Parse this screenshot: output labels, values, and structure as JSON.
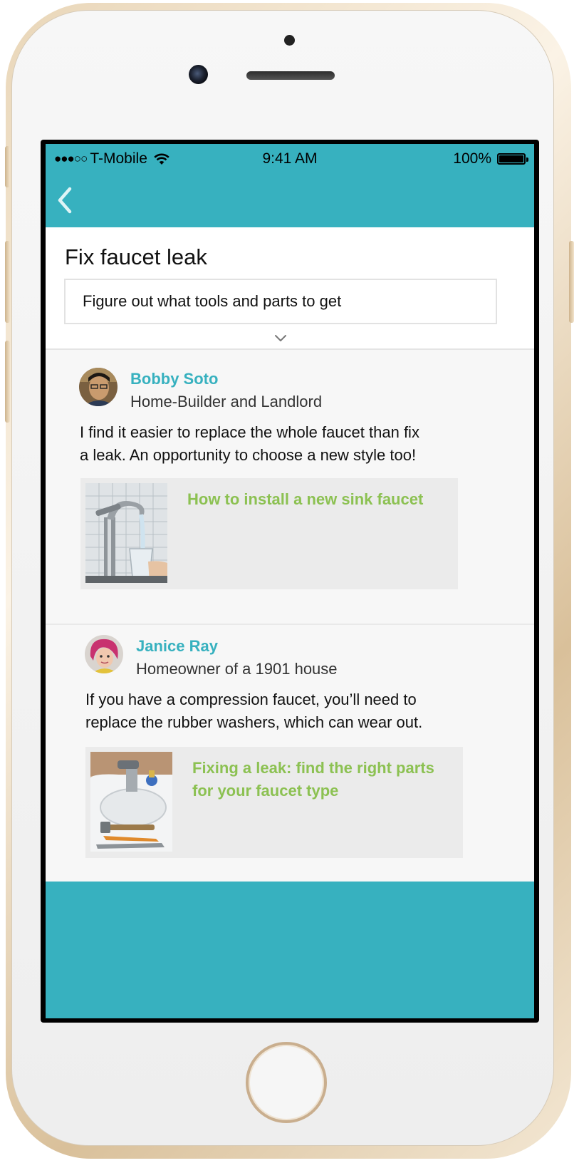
{
  "status_bar": {
    "signal": "●●●○○",
    "carrier": "T-Mobile",
    "time": "9:41 AM",
    "battery": "100%"
  },
  "nav": {
    "back_icon": "chevron-left-icon"
  },
  "task": {
    "title": "Fix faucet leak",
    "step": "Figure out what tools and parts to get",
    "expand_icon": "chevron-down-icon"
  },
  "answers": [
    {
      "author": "Bobby Soto",
      "role": "Home-Builder and Landlord",
      "text_line1": "I find it easier to replace the whole faucet than fix",
      "text_line2": "a leak. An opportunity to choose a new style too!",
      "link_title": "How to install a new sink faucet"
    },
    {
      "author": "Janice Ray",
      "role": "Homeowner of a 1901 house",
      "text_line1": "If you have a compression faucet, you’ll need to",
      "text_line2": "replace the rubber washers, which can wear out.",
      "link_title_line1": "Fixing a leak: find the right parts",
      "link_title_line2": "for your faucet type"
    }
  ],
  "colors": {
    "accent": "#37b1bf",
    "link": "#8cc152",
    "card_bg": "#ebebeb",
    "page_bg": "#f7f7f7"
  }
}
